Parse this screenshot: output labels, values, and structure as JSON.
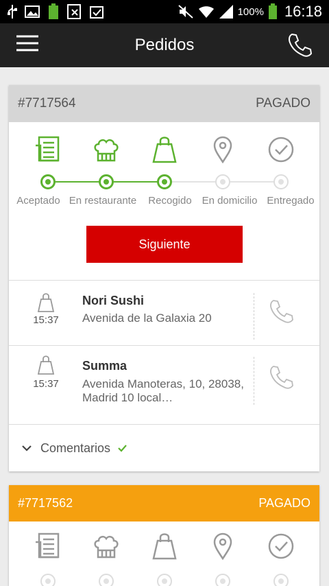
{
  "status_bar": {
    "battery_pct": "100%",
    "time": "16:18",
    "icons": [
      "usb-icon",
      "image-icon",
      "battery-app-icon",
      "bx-icon",
      "clipboard-icon",
      "silent-icon",
      "wifi-icon",
      "signal-icon",
      "battery-icon"
    ]
  },
  "app_bar": {
    "title": "Pedidos",
    "menu_icon": "hamburger-icon",
    "call_icon": "phone-icon"
  },
  "colors": {
    "app_bar": "#222222",
    "done_green": "#5cb22f",
    "button_red": "#d50000",
    "pending_orange": "#f5a00f"
  },
  "orders": [
    {
      "id": "#7717564",
      "status": "PAGADO",
      "steps": [
        {
          "label": "Aceptado",
          "icon": "order-list-icon",
          "done": true
        },
        {
          "label": "En restaurante",
          "icon": "chef-hat-icon",
          "done": true
        },
        {
          "label": "Recogido",
          "icon": "shopping-bag-icon",
          "done": true
        },
        {
          "label": "En domicilio",
          "icon": "location-pin-icon",
          "done": false
        },
        {
          "label": "Entregado",
          "icon": "check-circle-icon",
          "done": false
        }
      ],
      "next_button": "Siguiente",
      "stops": [
        {
          "time": "15:37",
          "name": "Nori Sushi",
          "address": "Avenida de la Galaxia 20"
        },
        {
          "time": "15:37",
          "name": "Summa",
          "address": "Avenida Manoteras, 10, 28038, Madrid 10 local…"
        }
      ],
      "comments_label": "Comentarios"
    },
    {
      "id": "#7717562",
      "status": "PAGADO"
    }
  ]
}
